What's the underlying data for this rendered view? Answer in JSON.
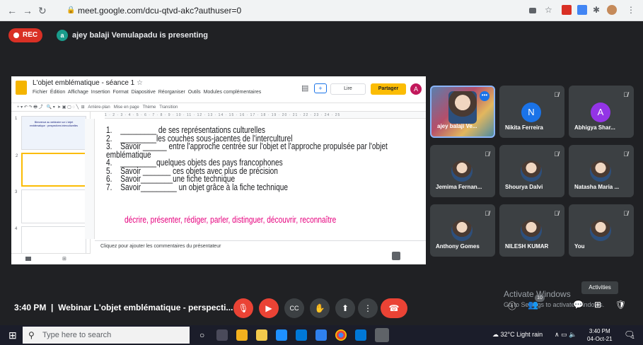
{
  "browser": {
    "url": "meet.google.com/dcu-qtvd-akc?authuser=0"
  },
  "meet": {
    "rec_label": "REC",
    "presenter_initial": "a",
    "presenting_text": "ajey balaji Vemulapadu is presenting",
    "meeting_time": "3:40 PM",
    "separator": "|",
    "meeting_title": "Webinar L'objet emblématique - perspecti..."
  },
  "slides_app": {
    "title": "L'objet emblématique - séance 1",
    "menu": [
      "Fichier",
      "Édition",
      "Affichage",
      "Insertion",
      "Format",
      "Diapositive",
      "Réorganiser",
      "Outils",
      "Modules complémentaires"
    ],
    "read_label": "Lire",
    "share_label": "Partager",
    "user_initial": "A",
    "toolbar_items": [
      "Arrière-plan",
      "Mise en page",
      "Thème",
      "Transition"
    ],
    "ruler": "1 · 2 · 3 · 4 · 5 · 6 · 7 · 8 · 9 · 10 · 11 · 12 · 13 · 14 · 15 · 16 · 17 · 18 · 19 · 20 · 21 · 22 · 23 · 24 · 25",
    "thumb_numbers": [
      "1",
      "2",
      "3",
      "4"
    ],
    "thumb1_title": "Bienvenue au webinaire sur L'objet emblématique : perspectives interculturelles",
    "notes_placeholder": "Cliquez pour ajouter les commentaires du présentateur"
  },
  "slide": {
    "items": [
      {
        "n": "1.",
        "text": "_________ de ses représentations culturelles"
      },
      {
        "n": "2.",
        "text": "_________les couches sous-jacentes de l'interculturel"
      },
      {
        "n": "3.",
        "text": "Savoir ______ entre l'approche centrée sur l'objet et l'approche propulsée par l'objet emblématique"
      },
      {
        "n": "4.",
        "text": "_________quelques objets des pays francophones"
      },
      {
        "n": "5.",
        "text": "Savoir _______ ces objets avec plus de précision"
      },
      {
        "n": "6.",
        "text": "Savoir________une fiche technique"
      },
      {
        "n": "7.",
        "text": "Savoir_________ un objet grâce à la fiche technique"
      }
    ],
    "word_bank": "décrire, présenter, rédiger, parler, distinguer, découvrir, reconnaître"
  },
  "participants": [
    {
      "name": "ajey balaji Ve...",
      "initial": ""
    },
    {
      "name": "Nikita Ferreira",
      "initial": "N",
      "color": "#1a73e8"
    },
    {
      "name": "Abhigya Shar...",
      "initial": "A",
      "color": "#9334e6"
    },
    {
      "name": "Jemima Fernan...",
      "initial": ""
    },
    {
      "name": "Shourya Dalvi",
      "initial": ""
    },
    {
      "name": "Natasha Maria ...",
      "initial": ""
    },
    {
      "name": "Anthony Gomes",
      "initial": ""
    },
    {
      "name": "NILESH KUMAR",
      "initial": ""
    },
    {
      "name": "You",
      "initial": ""
    }
  ],
  "overlay": {
    "activate_title": "Activate Windows",
    "activate_sub": "Go to Settings to activate Windows.",
    "activities": "Activities",
    "people_count": "10"
  },
  "taskbar": {
    "search_placeholder": "Type here to search",
    "weather": "32°C  Light rain",
    "time": "3:40 PM",
    "date": "04-Oct-21",
    "notification_count": "1"
  }
}
